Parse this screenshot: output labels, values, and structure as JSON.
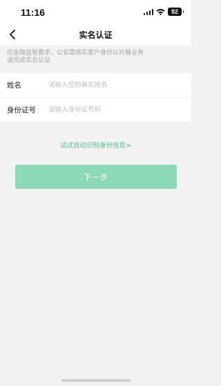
{
  "status_bar": {
    "time": "11:16",
    "battery": "92"
  },
  "nav": {
    "title": "实名认证"
  },
  "notice": {
    "line1": "应金融监管要求，公安需核实客户身份以开展业务",
    "line2": "请完成实名认证"
  },
  "form": {
    "name_label": "姓名",
    "name_placeholder": "请输入您的真实姓名",
    "id_label": "身份证号",
    "id_placeholder": "请输入身份证号码"
  },
  "auto_identify": {
    "label": "试试自动识别身份信息>"
  },
  "next_button": {
    "label": "下一步"
  },
  "colors": {
    "accent": "#4cc38a",
    "button_bg": "#8ad9b4",
    "page_bg": "#f2f2f2"
  }
}
